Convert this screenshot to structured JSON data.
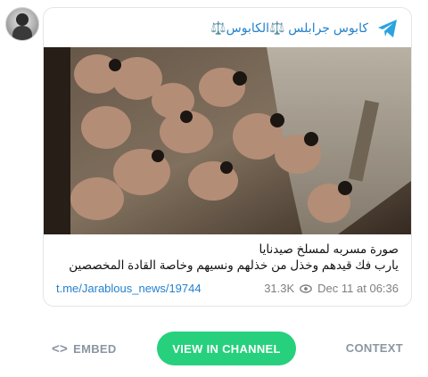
{
  "channel": {
    "name": "كابوس جرابلس ⚖️الكابوس⚖️",
    "avatar_alt": "channel avatar"
  },
  "post": {
    "caption_lines": [
      "صورة مسربه لمسلخ صيدنايا",
      "يارب فك قيدهم وخذل من خذلهم ونسيهم وخاصة القادة المخصصين"
    ],
    "link": "t.me/Jarablous_news/19744",
    "views": "31.3K",
    "date": "Dec 11 at 06:36"
  },
  "actions": {
    "embed_label": "EMBED",
    "view_label": "VIEW IN CHANNEL",
    "context_label": "CONTEXT"
  },
  "colors": {
    "accent": "#2481cc",
    "button": "#26d07c",
    "muted": "#8a96a3"
  }
}
